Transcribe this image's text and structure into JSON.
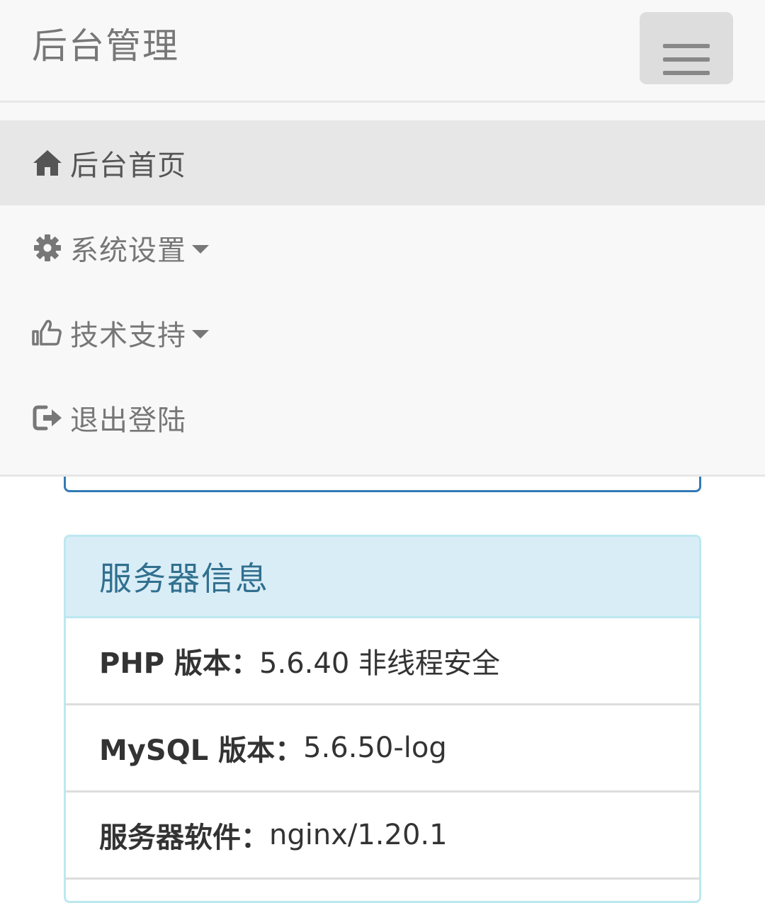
{
  "navbar": {
    "brand": "后台管理",
    "toggle_icon": "menu-icon"
  },
  "menu": {
    "items": [
      {
        "label": "后台首页",
        "icon": "home-icon",
        "active": true
      },
      {
        "label": "系统设置",
        "icon": "gear-icon",
        "dropdown": true
      },
      {
        "label": "技术支持",
        "icon": "thumbs-up-icon",
        "dropdown": true
      },
      {
        "label": "退出登陆",
        "icon": "logout-icon"
      }
    ]
  },
  "server_info": {
    "title": "服务器信息",
    "rows": [
      {
        "key": "PHP 版本：",
        "value": "5.6.40 非线程安全"
      },
      {
        "key": "MySQL 版本：",
        "value": "5.6.50-log"
      },
      {
        "key": "服务器软件：",
        "value": "nginx/1.20.1"
      }
    ]
  },
  "colors": {
    "navbar_bg": "#f8f8f8",
    "active_item_bg": "#e7e7e7",
    "panel_heading_bg": "#d9edf7",
    "panel_heading_text": "#31708f",
    "panel_border": "#bce8f1",
    "primary_border": "#337ab7"
  }
}
